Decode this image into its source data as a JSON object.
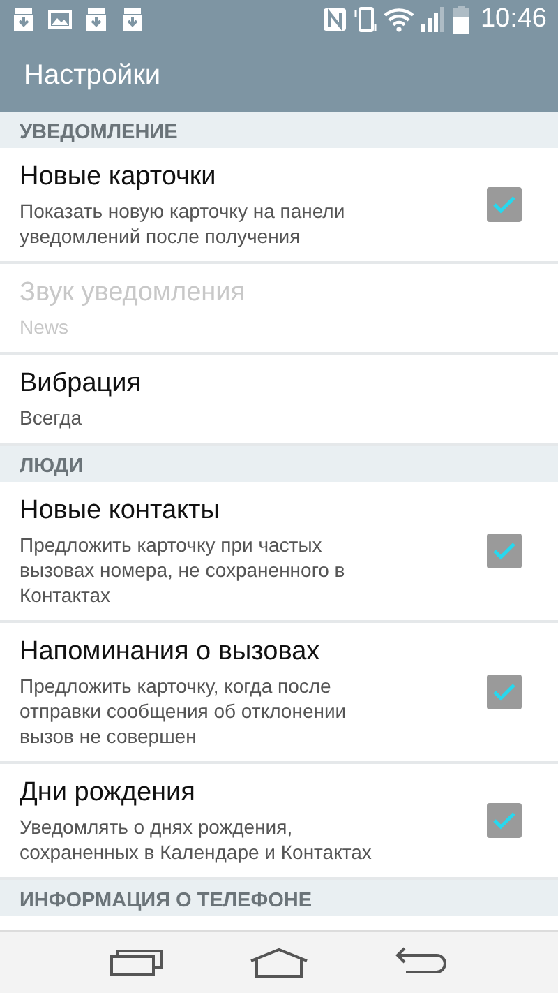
{
  "status_bar": {
    "time": "10:46"
  },
  "app_bar": {
    "title": "Настройки"
  },
  "sections": [
    {
      "header": "УВЕДОМЛЕНИЕ",
      "items": [
        {
          "kind": "checkbox",
          "title": "Новые карточки",
          "summary": "Показать новую карточку на панели уведомлений после получения",
          "checked": true,
          "disabled": false
        },
        {
          "kind": "text",
          "title": "Звук уведомления",
          "summary": "News",
          "disabled": true
        },
        {
          "kind": "text",
          "title": "Вибрация",
          "summary": "Всегда",
          "disabled": false
        }
      ]
    },
    {
      "header": "ЛЮДИ",
      "items": [
        {
          "kind": "checkbox",
          "title": "Новые контакты",
          "summary": "Предложить карточку при частых вызовах номера, не сохраненного в Контактах",
          "checked": true,
          "disabled": false
        },
        {
          "kind": "checkbox",
          "title": "Напоминания о вызовах",
          "summary": "Предложить карточку, когда после отправки сообщения об отклонении вызов не совершен",
          "checked": true,
          "disabled": false
        },
        {
          "kind": "checkbox",
          "title": "Дни рождения",
          "summary": "Уведомлять о днях рождения, сохраненных в Календаре и Контактах",
          "checked": true,
          "disabled": false
        }
      ]
    },
    {
      "header": "ИНФОРМАЦИЯ О ТЕЛЕФОНЕ"
    }
  ]
}
